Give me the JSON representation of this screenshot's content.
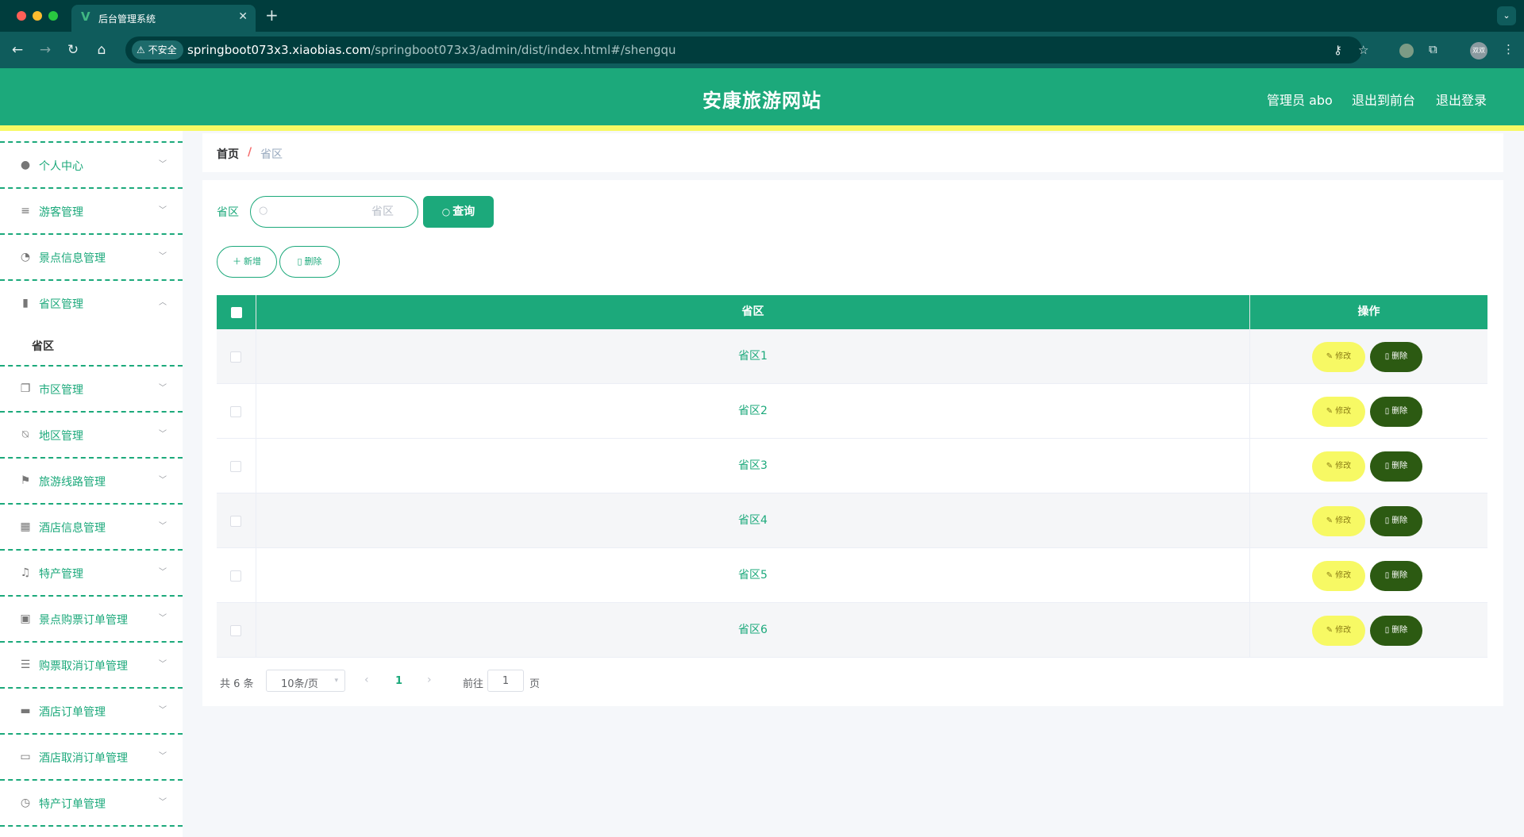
{
  "browser": {
    "tab_title": "后台管理系统",
    "tab_favicon": "V",
    "tab_close": "✕",
    "new_tab": "+",
    "insecure_label": "不安全",
    "url_host": "springboot073x3.xiaobias.com",
    "url_path": "/springboot073x3/admin/dist/index.html#/shengqu",
    "profile_label": "双双"
  },
  "header": {
    "site_title": "安康旅游网站",
    "user_label": "管理员 abo",
    "front_link": "退出到前台",
    "logout_link": "退出登录",
    "brand_color": "#1ca97b",
    "accent_color": "#f7f964"
  },
  "sidebar": {
    "items": [
      {
        "label": "个人中心",
        "icon": "user-icon",
        "expanded": false
      },
      {
        "label": "游客管理",
        "icon": "list-icon",
        "expanded": false
      },
      {
        "label": "景点信息管理",
        "icon": "compass-icon",
        "expanded": false
      },
      {
        "label": "省区管理",
        "icon": "chart-icon",
        "expanded": true
      },
      {
        "label": "市区管理",
        "icon": "copy-icon",
        "expanded": false
      },
      {
        "label": "地区管理",
        "icon": "bell-off-icon",
        "expanded": false
      },
      {
        "label": "旅游线路管理",
        "icon": "flag-icon",
        "expanded": false
      },
      {
        "label": "酒店信息管理",
        "icon": "grid-icon",
        "expanded": false
      },
      {
        "label": "特产管理",
        "icon": "microphone-icon",
        "expanded": false
      },
      {
        "label": "景点购票订单管理",
        "icon": "clipboard-icon",
        "expanded": false
      },
      {
        "label": "购票取消订单管理",
        "icon": "list-lines-icon",
        "expanded": false
      },
      {
        "label": "酒店订单管理",
        "icon": "monitor-icon",
        "expanded": false
      },
      {
        "label": "酒店取消订单管理",
        "icon": "printer-icon",
        "expanded": false
      },
      {
        "label": "特产订单管理",
        "icon": "clock-icon",
        "expanded": false
      }
    ],
    "submenu": {
      "label": "省区"
    }
  },
  "breadcrumb": {
    "home": "首页",
    "separator": "/",
    "current": "省区"
  },
  "search": {
    "label": "省区",
    "placeholder": "省区",
    "value": "",
    "query_button": "查询"
  },
  "actions": {
    "add_label": "新增",
    "delete_label": "删除"
  },
  "table": {
    "columns": [
      "省区",
      "操作"
    ],
    "rows": [
      {
        "name": "省区1",
        "edit": "修改",
        "delete": "删除"
      },
      {
        "name": "省区2",
        "edit": "修改",
        "delete": "删除"
      },
      {
        "name": "省区3",
        "edit": "修改",
        "delete": "删除"
      },
      {
        "name": "省区4",
        "edit": "修改",
        "delete": "删除"
      },
      {
        "name": "省区5",
        "edit": "修改",
        "delete": "删除"
      },
      {
        "name": "省区6",
        "edit": "修改",
        "delete": "删除"
      }
    ]
  },
  "pagination": {
    "total_text": "共 6 条",
    "page_size": "10条/页",
    "current_page": "1",
    "goto_label": "前往",
    "goto_value": "1",
    "page_suffix": "页"
  }
}
